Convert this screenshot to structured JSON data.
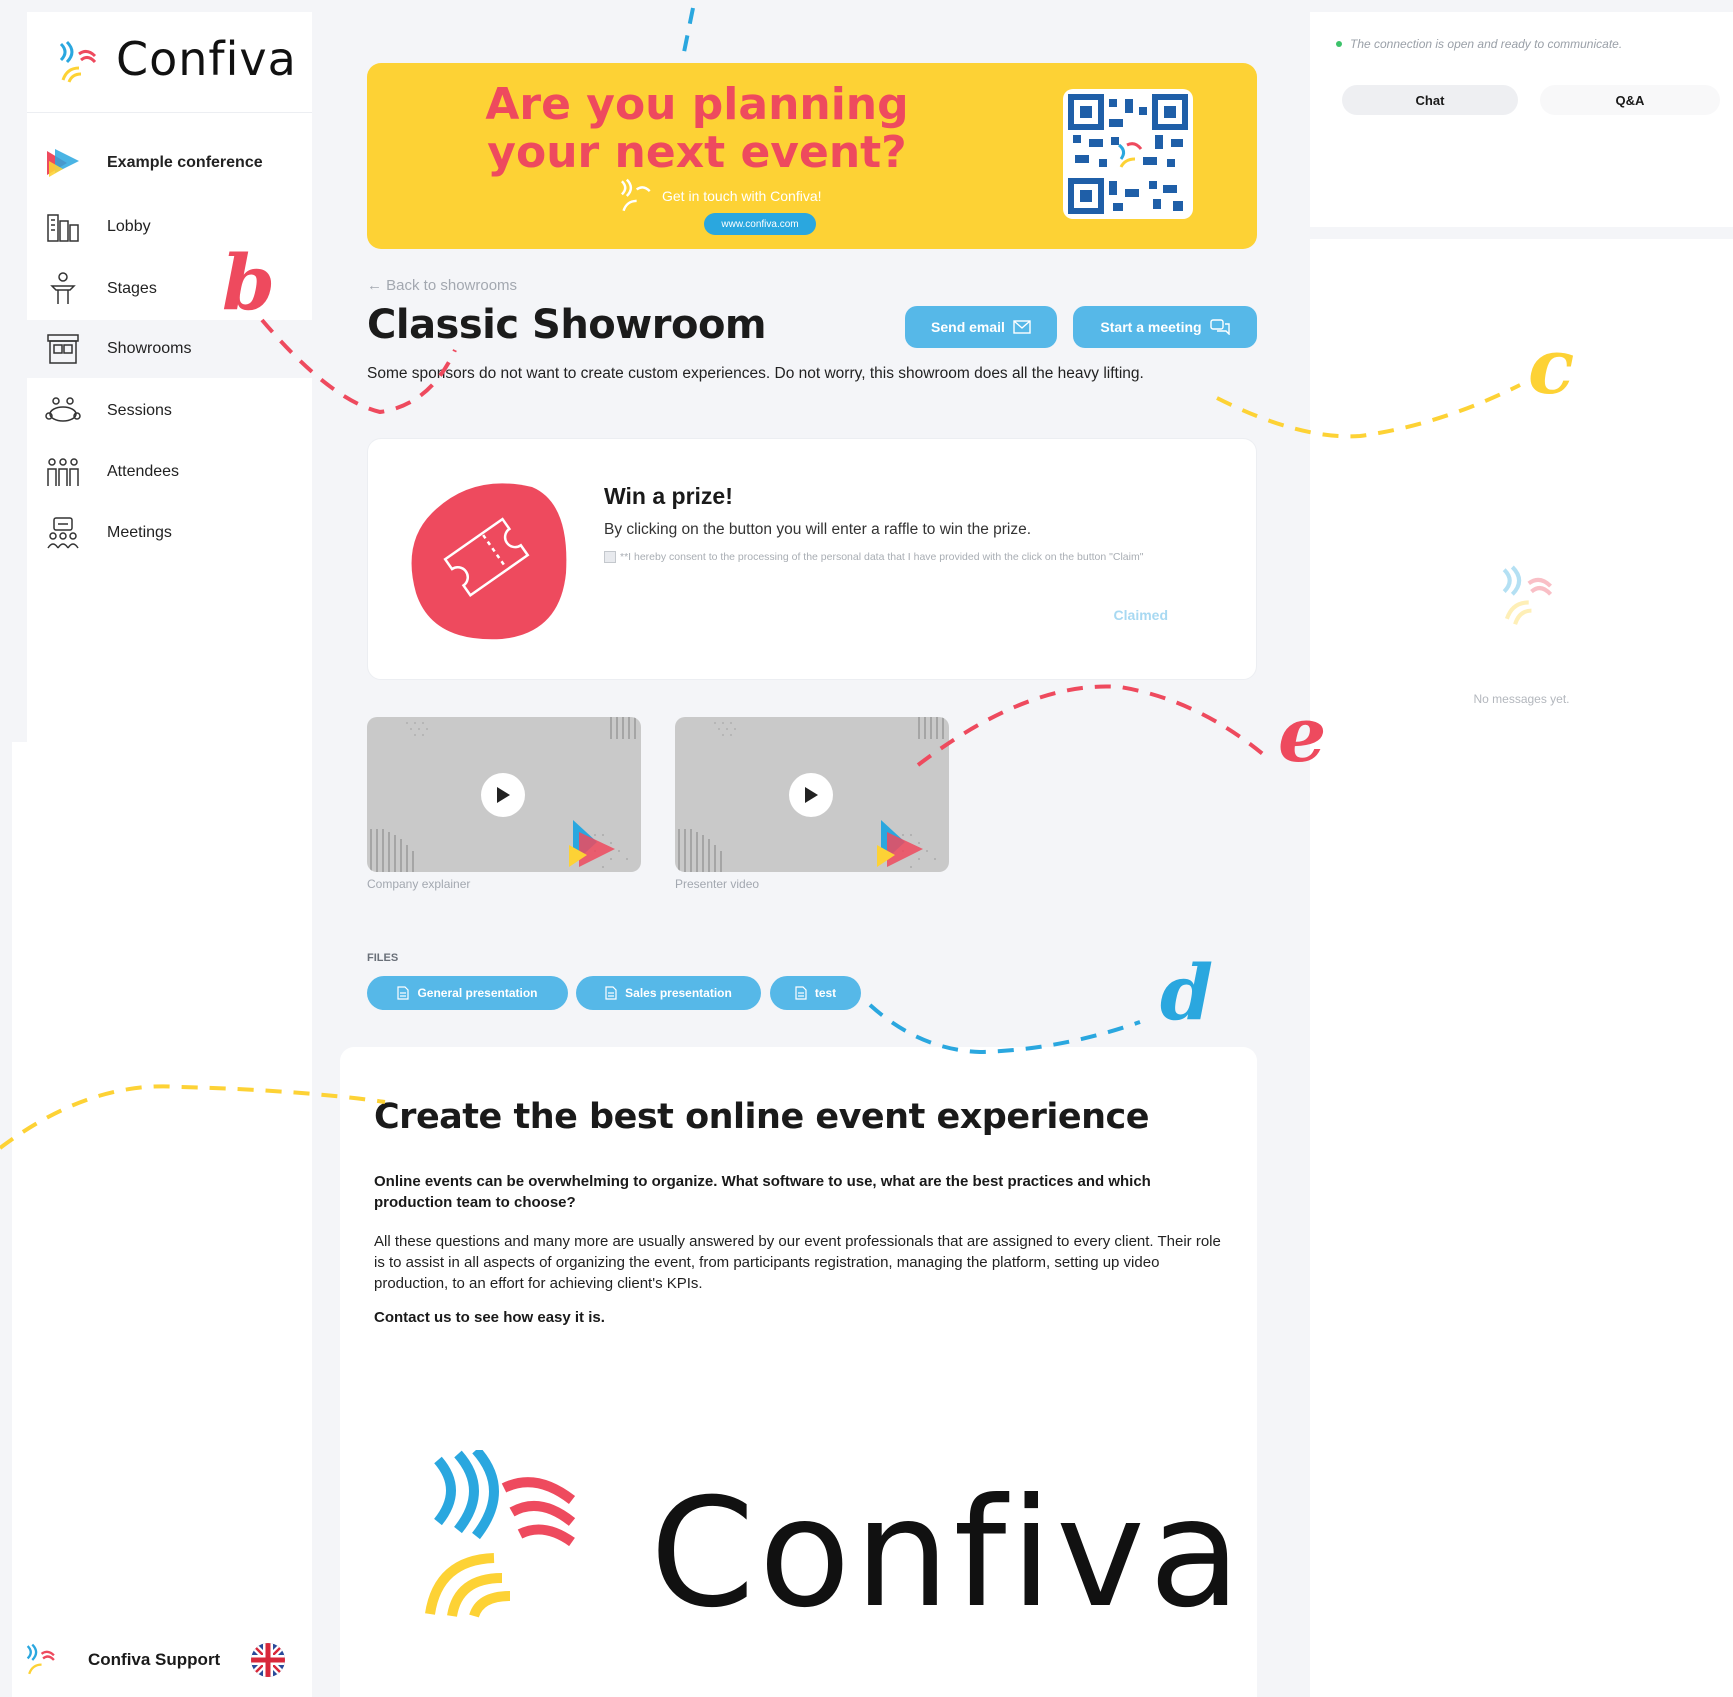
{
  "app": {
    "brand": "Confiva"
  },
  "sidebar": {
    "conference": "Example conference",
    "items": [
      {
        "label": "Lobby",
        "icon": "building-icon"
      },
      {
        "label": "Stages",
        "icon": "podium-icon"
      },
      {
        "label": "Showrooms",
        "icon": "booth-icon",
        "active": true
      },
      {
        "label": "Sessions",
        "icon": "round-table-icon"
      },
      {
        "label": "Attendees",
        "icon": "people-icon"
      },
      {
        "label": "Meetings",
        "icon": "meeting-icon"
      }
    ],
    "support_label": "Confiva Support",
    "language_icon": "uk-flag-icon"
  },
  "banner": {
    "title": "Are you planning your next event?",
    "subtitle": "Get in touch with Confiva!",
    "link": "www.confiva.com",
    "bg_color": "#fdd235",
    "title_color": "#ee4a5e"
  },
  "showroom": {
    "back_label": "Back to showrooms",
    "title": "Classic Showroom",
    "send_email_label": "Send email",
    "start_meeting_label": "Start a meeting",
    "description": "Some sponsors do not want to create custom experiences. Do not worry, this showroom does all the heavy lifting."
  },
  "prize": {
    "title": "Win a prize!",
    "text": "By clicking on the button you will enter a raffle to win the prize.",
    "consent": "**I hereby consent to the processing of the personal data that I have provided with the click on the button \"Claim\"",
    "claimed_label": "Claimed"
  },
  "videos": [
    {
      "caption": "Company explainer"
    },
    {
      "caption": "Presenter video"
    }
  ],
  "files": {
    "label": "FILES",
    "items": [
      "General presentation",
      "Sales presentation",
      "test"
    ]
  },
  "content": {
    "title": "Create the best online event experience",
    "lead": "Online events can be overwhelming to organize. What software to use, what are the best practices and which production team to choose?",
    "body": "All these questions and many more are usually answered by our event professionals that are assigned to every client. Their role is to assist in all aspects of organizing the event, from participants registration, managing the platform, setting up video production, to an effort for achieving client's KPIs.",
    "cta": "Contact us to see how easy it is.",
    "logo_word": "Confiva"
  },
  "chat_panel": {
    "status": "The connection is open and ready to communicate.",
    "tabs": [
      "Chat",
      "Q&A"
    ],
    "empty": "No messages yet."
  },
  "annotations": [
    "b",
    "c",
    "d",
    "e"
  ],
  "colors": {
    "accent_blue": "#56b8e8",
    "brand_red": "#ee4a5e",
    "brand_yellow": "#fdd235",
    "brand_blue": "#2aa7df"
  }
}
